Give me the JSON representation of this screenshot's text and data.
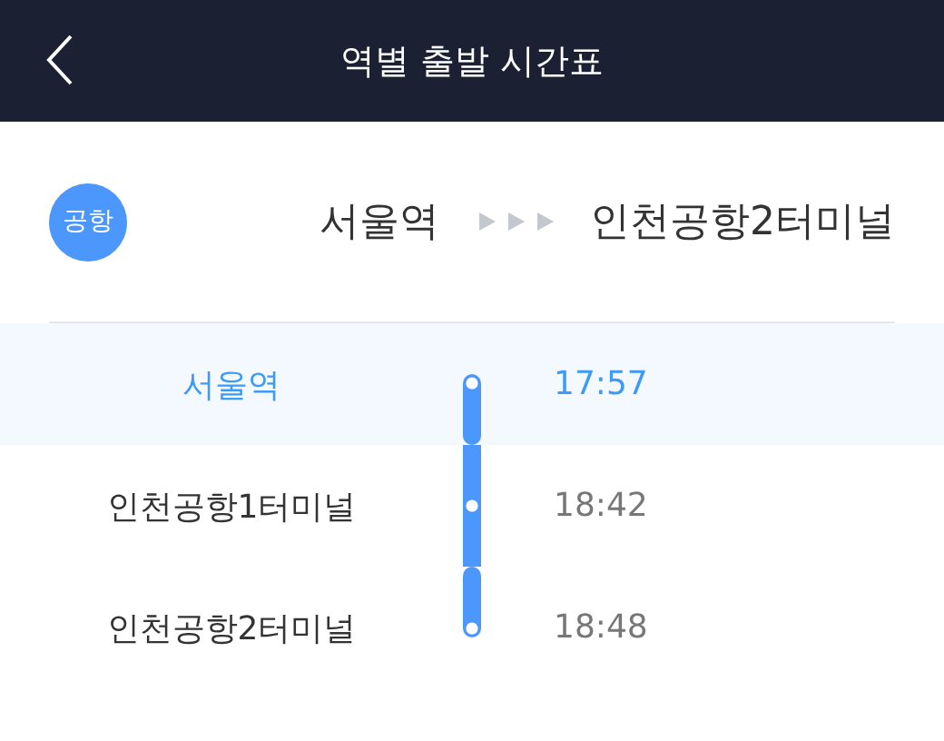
{
  "header": {
    "title": "역별 출발 시간표"
  },
  "route": {
    "badge": "공항",
    "origin": "서울역",
    "destination": "인천공항2터미널"
  },
  "stops": [
    {
      "station": "서울역",
      "time": "17:57",
      "selected": true
    },
    {
      "station": "인천공항1터미널",
      "time": "18:42",
      "selected": false
    },
    {
      "station": "인천공항2터미널",
      "time": "18:48",
      "selected": false
    }
  ]
}
